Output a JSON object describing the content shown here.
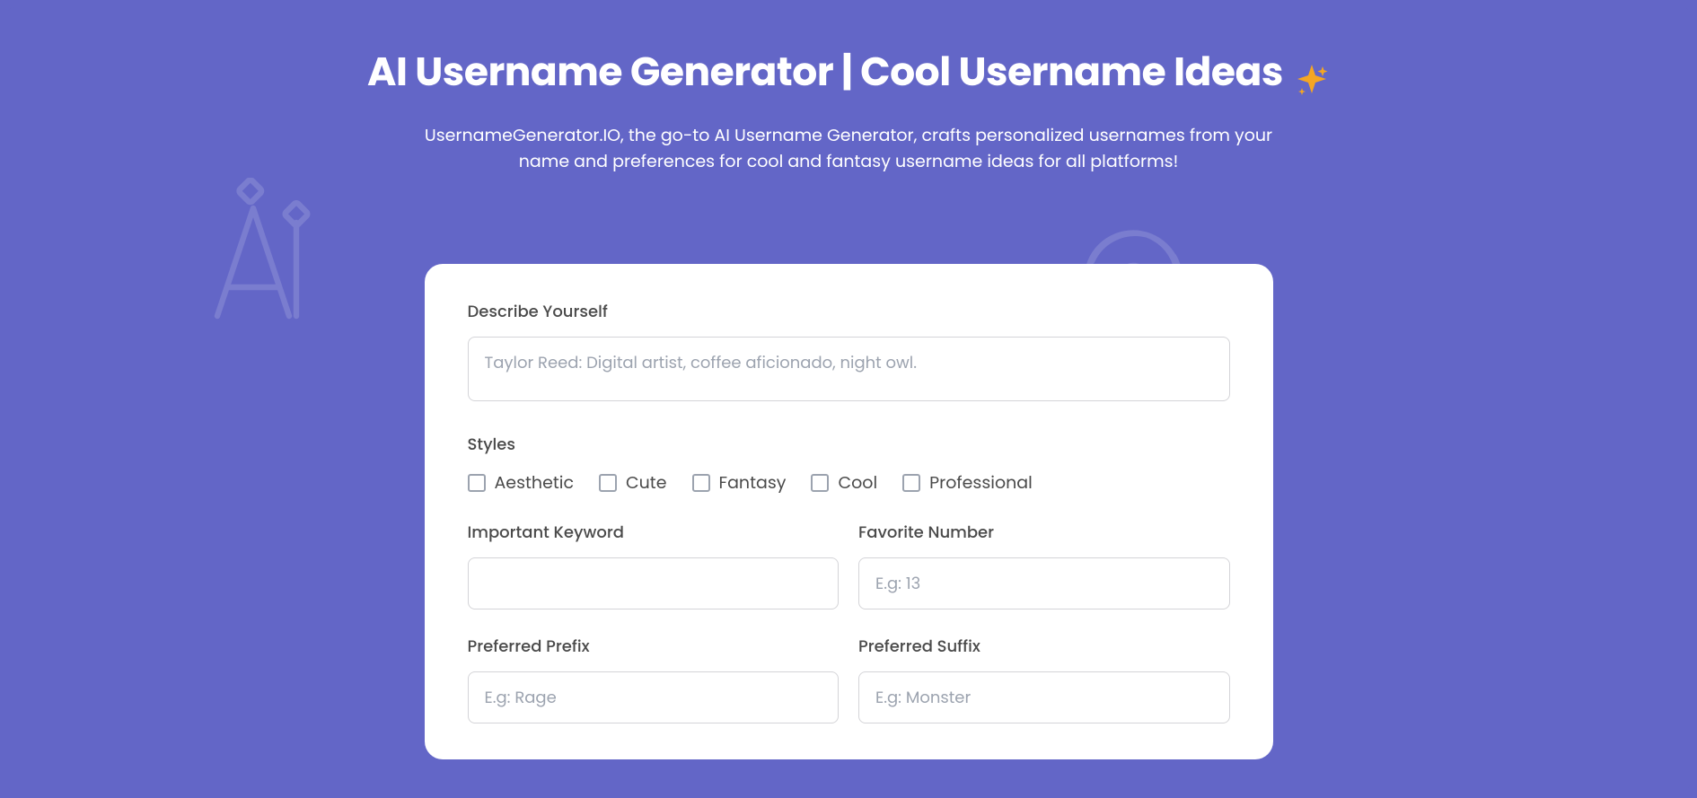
{
  "hero": {
    "title": "AI Username Generator | Cool Username Ideas",
    "subtitle": "UsernameGenerator.IO, the go-to AI Username Generator, crafts personalized usernames from your name and preferences for cool and fantasy username ideas for all platforms!"
  },
  "form": {
    "describe_label": "Describe Yourself",
    "describe_placeholder": "Taylor Reed: Digital artist, coffee aficionado, night owl.",
    "styles_label": "Styles",
    "styles": [
      {
        "label": "Aesthetic"
      },
      {
        "label": "Cute"
      },
      {
        "label": "Fantasy"
      },
      {
        "label": "Cool"
      },
      {
        "label": "Professional"
      }
    ],
    "keyword_label": "Important Keyword",
    "keyword_placeholder": "",
    "favnum_label": "Favorite Number",
    "favnum_placeholder": "E.g: 13",
    "prefix_label": "Preferred Prefix",
    "prefix_placeholder": "E.g: Rage",
    "suffix_label": "Preferred Suffix",
    "suffix_placeholder": "E.g: Monster"
  }
}
